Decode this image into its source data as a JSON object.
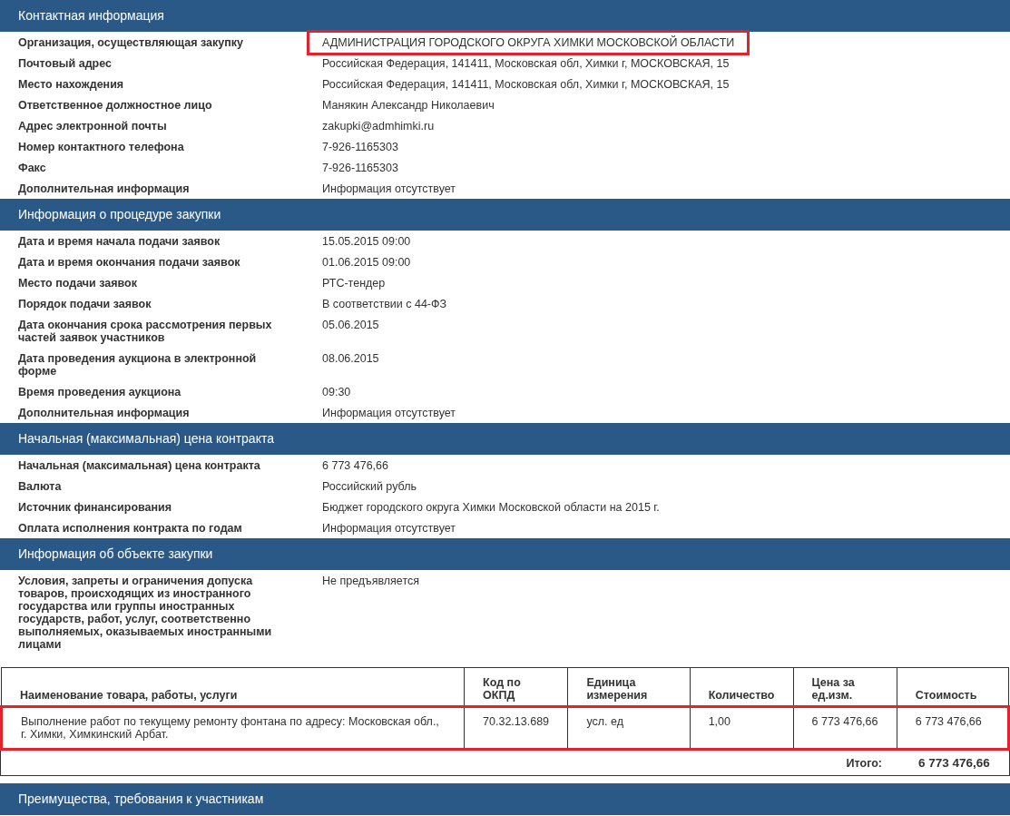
{
  "sections": [
    {
      "title": "Контактная информация",
      "rows": [
        {
          "label": "Организация, осуществляющая закупку",
          "value": "АДМИНИСТРАЦИЯ ГОРОДСКОГО ОКРУГА ХИМКИ МОСКОВСКОЙ ОБЛАСТИ",
          "highlighted": true
        },
        {
          "label": "Почтовый адрес",
          "value": "Российская Федерация, 141411, Московская обл, Химки г, МОСКОВСКАЯ, 15",
          "highlighted": false
        },
        {
          "label": "Место нахождения",
          "value": "Российская Федерация, 141411, Московская обл, Химки г, МОСКОВСКАЯ, 15",
          "highlighted": false
        },
        {
          "label": "Ответственное должностное лицо",
          "value": "Манякин Александр Николаевич",
          "highlighted": false
        },
        {
          "label": "Адрес электронной почты",
          "value": "zakupki@admhimki.ru",
          "highlighted": false
        },
        {
          "label": "Номер контактного телефона",
          "value": "7-926-1165303",
          "highlighted": false
        },
        {
          "label": "Факс",
          "value": "7-926-1165303",
          "highlighted": false
        },
        {
          "label": "Дополнительная информация",
          "value": "Информация отсутствует",
          "highlighted": false
        }
      ]
    },
    {
      "title": "Информация о процедуре закупки",
      "rows": [
        {
          "label": "Дата и время начала подачи заявок",
          "value": "15.05.2015 09:00",
          "highlighted": false
        },
        {
          "label": "Дата и время окончания подачи заявок",
          "value": "01.06.2015 09:00",
          "highlighted": false
        },
        {
          "label": "Место подачи заявок",
          "value": "РТС-тендер",
          "highlighted": false
        },
        {
          "label": "Порядок подачи заявок",
          "value": "В соответствии с 44-ФЗ",
          "highlighted": false
        },
        {
          "label": "Дата окончания срока рассмотрения первых частей заявок участников",
          "value": "05.06.2015",
          "highlighted": false
        },
        {
          "label": "Дата проведения аукциона в электронной форме",
          "value": "08.06.2015",
          "highlighted": false
        },
        {
          "label": "Время проведения аукциона",
          "value": "09:30",
          "highlighted": false
        },
        {
          "label": "Дополнительная информация",
          "value": "Информация отсутствует",
          "highlighted": false
        }
      ]
    },
    {
      "title": "Начальная (максимальная) цена контракта",
      "rows": [
        {
          "label": "Начальная (максимальная) цена контракта",
          "value": "6 773 476,66",
          "highlighted": false
        },
        {
          "label": "Валюта",
          "value": "Российский рубль",
          "highlighted": false
        },
        {
          "label": "Источник финансирования",
          "value": "Бюджет городского округа Химки Московской области на 2015 г.",
          "highlighted": false
        },
        {
          "label": "Оплата исполнения контракта по годам",
          "value": "Информация отсутствует",
          "highlighted": false
        }
      ]
    },
    {
      "title": "Информация об объекте закупки",
      "rows": [
        {
          "label": "Условия, запреты и ограничения допуска товаров, происходящих из иностранного государства или группы иностранных государств, работ, услуг, соответственно выполняемых, оказываемых иностранными лицами",
          "value": "Не предъявляется",
          "highlighted": false
        }
      ],
      "table": {
        "columns": [
          "Наименование товара, работы, услуги",
          "Код по ОКПД",
          "Единица измерения",
          "Количество",
          "Цена за ед.изм.",
          "Стоимость"
        ],
        "rows": [
          {
            "cells": [
              "Выполнение работ по текущему ремонту фонтана по адресу: Московская обл., г. Химки, Химкинский Арбат.",
              "70.32.13.689",
              "усл. ед",
              "1,00",
              "6 773 476,66",
              "6 773 476,66"
            ],
            "highlighted": true
          }
        ],
        "total_label": "Итого:",
        "total_value": "6 773 476,66"
      }
    },
    {
      "title": "Преимущества, требования к участникам"
    }
  ]
}
